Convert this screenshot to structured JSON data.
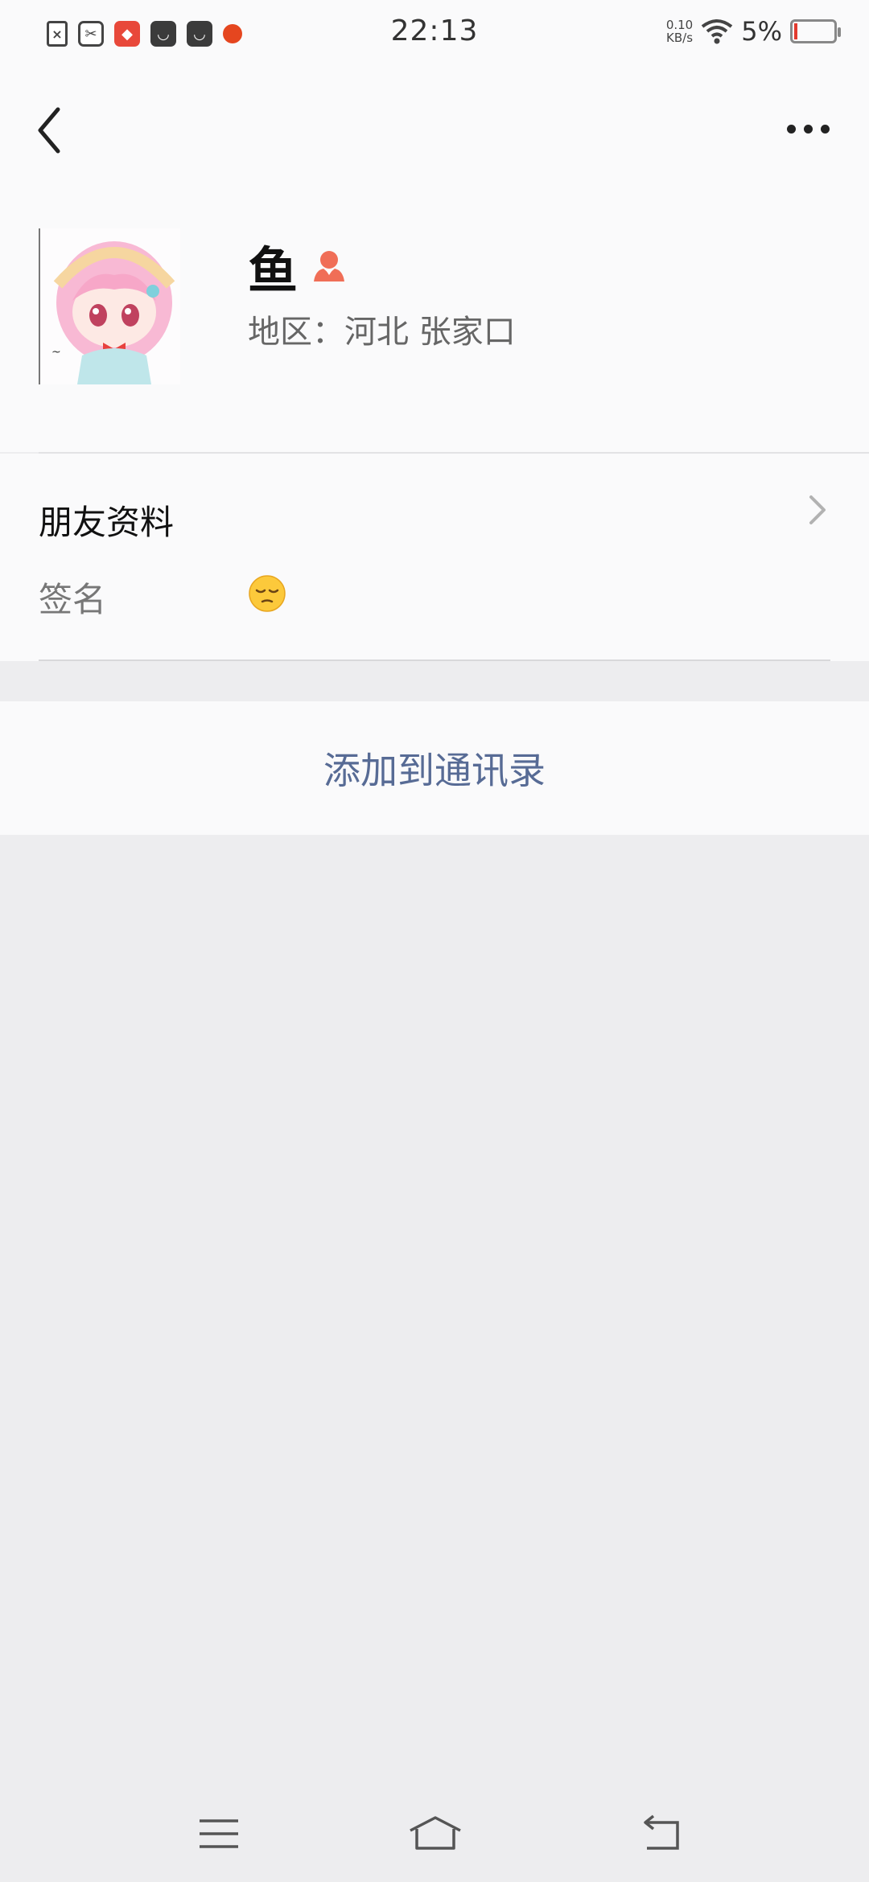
{
  "status_bar": {
    "time": "22:13",
    "network_speed_value": "0.10",
    "network_speed_unit": "KB/s",
    "battery_percent": "5%",
    "battery_color": "#e23a2e"
  },
  "nav": {
    "back_icon": "chevron-left-icon",
    "more_icon": "more-dots-icon"
  },
  "profile": {
    "name": "鱼",
    "gender_icon": "female-user-icon",
    "gender_color": "#f06e57",
    "region": "地区：河北  张家口"
  },
  "friend_info": {
    "title": "朋友资料",
    "signature_label": "签名",
    "signature_value": "😔"
  },
  "actions": {
    "add_to_contacts": "添加到通讯录",
    "link_color": "#576b95"
  }
}
